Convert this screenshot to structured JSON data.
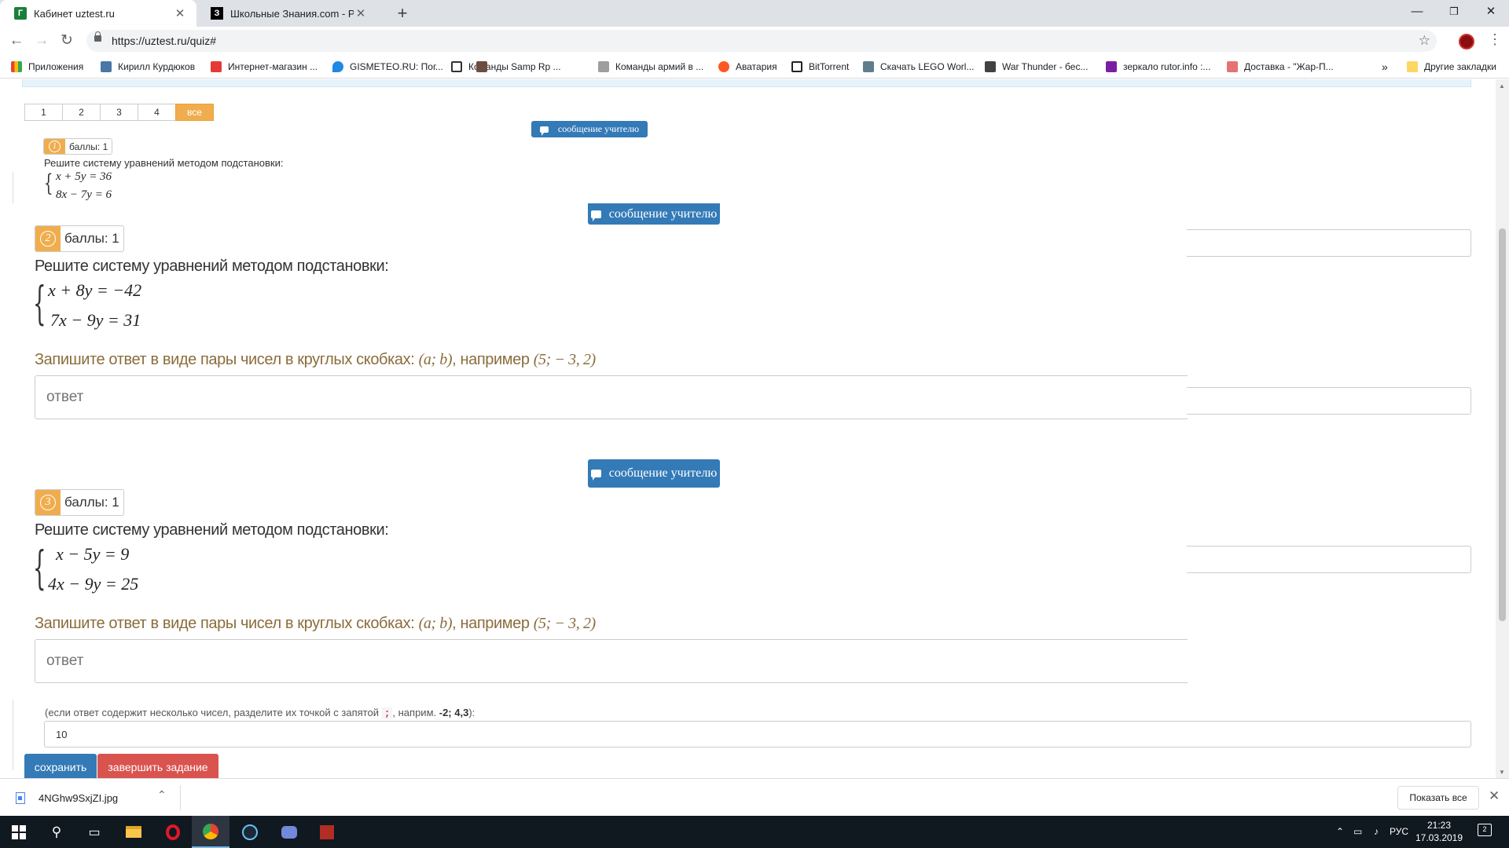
{
  "browser": {
    "tabs": [
      {
        "title": "Кабинет uztest.ru",
        "active": true
      },
      {
        "title": "Школьные Знания.com - Решае",
        "active": false
      }
    ],
    "url": "https://uztest.ru/quiz#",
    "bookmarks": [
      "Приложения",
      "Кирилл Курдюков",
      "Интернет-магазин ...",
      "GISMETEO.RU: Пог...",
      "Команды Samp Rp ...",
      "Команды армий в ...",
      "Аватария",
      "BitTorrent",
      "Скачать LEGO Worl...",
      "War Thunder - бес...",
      "зеркало rutor.info :...",
      "Доставка - \"Жар-П..."
    ],
    "bookmarks_more": "»",
    "other_bookmarks": "Другие закладки"
  },
  "quiz": {
    "pages": [
      "1",
      "2",
      "3",
      "4",
      "все"
    ],
    "active_page": "все",
    "message_label": "сообщение учителю",
    "points_label": "баллы: 1",
    "instruction": "Решите систему уравнений методом подстановки:",
    "answer_hint_prefix": "Запишите ответ в виде пары чисел в круглых скобках:",
    "answer_hint_var": "(a; b)",
    "answer_hint_mid": ", например",
    "answer_hint_example": "(5; − 3, 2)",
    "answer_placeholder": "ответ",
    "questions": [
      {
        "num": "1",
        "eq1": "x + 5y = 36",
        "eq2": "8x − 7y = 6"
      },
      {
        "num": "2",
        "eq1": "x + 8y = −42",
        "eq2": "7x − 9y = 31"
      },
      {
        "num": "3",
        "eq1": "x − 5y = 9",
        "eq2": "4x − 9y = 25"
      }
    ],
    "multi_note_prefix": "(если ответ содержит несколько чисел, разделите их точкой с запятой",
    "multi_note_sep": ";",
    "multi_note_mid": ", наприм.",
    "multi_note_example": "-2; 4,3",
    "multi_note_suffix": "):",
    "answer_value": "10",
    "save_label": "сохранить",
    "finish_label": "завершить задание"
  },
  "download": {
    "filename": "4NGhw9SxjZI.jpg",
    "show_all": "Показать все"
  },
  "taskbar": {
    "lang": "РУС",
    "time": "21:23",
    "date": "17.03.2019",
    "notif_count": "2"
  },
  "colors": {
    "primary": "#337ab7",
    "warning": "#f0ad4e",
    "danger": "#d9534f",
    "hint": "#8a6d3b"
  }
}
